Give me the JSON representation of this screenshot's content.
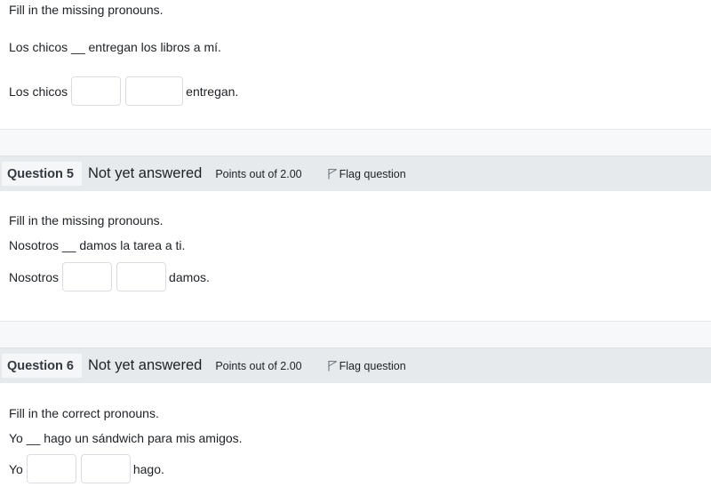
{
  "question4": {
    "instruction": "Fill in the missing pronouns.",
    "sentence": "Los chicos __ entregan los libros a mí.",
    "answer_prefix": "Los chicos",
    "answer_suffix": "entregan.",
    "blank1_value": "",
    "blank2_value": ""
  },
  "question5": {
    "label": "Question 5",
    "state": "Not yet answered",
    "points": "Points out of 2.00",
    "flag_label": "Flag question",
    "flag_icon": "flag-icon",
    "instruction": "Fill in the missing pronouns.",
    "sentence": "Nosotros __ damos la tarea a ti.",
    "answer_prefix": "Nosotros",
    "answer_suffix": "damos.",
    "blank1_value": "",
    "blank2_value": ""
  },
  "question6": {
    "label": "Question 6",
    "state": "Not yet answered",
    "points": "Points out of 2.00",
    "flag_label": "Flag question",
    "flag_icon": "flag-icon",
    "instruction": "Fill in the correct pronouns.",
    "sentence": "Yo __ hago un sándwich para mis amigos.",
    "answer_prefix": "Yo",
    "answer_suffix": "hago.",
    "blank1_value": "",
    "blank2_value": ""
  },
  "colors": {
    "header_bg": "#e7eaed",
    "label_bg": "#f5f6f7",
    "band_bg": "#f7f8fa",
    "text": "#1d2125",
    "input_border": "#d9dde2"
  }
}
